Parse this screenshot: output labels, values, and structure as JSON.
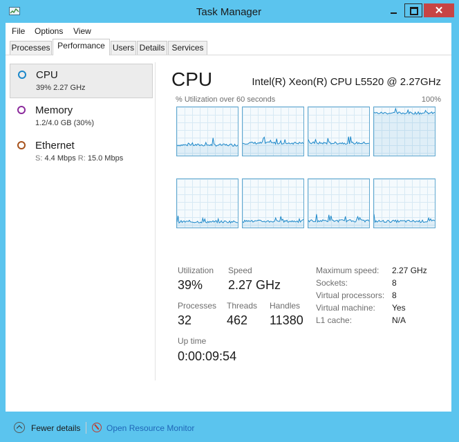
{
  "window": {
    "title": "Task Manager",
    "icon": "task-manager-icon",
    "controls": {
      "minimize": "minimize-icon",
      "maximize": "maximize-icon",
      "close_glyph": "✕"
    }
  },
  "menu": {
    "file": "File",
    "options": "Options",
    "view": "View"
  },
  "tabs": {
    "processes": "Processes",
    "performance": "Performance",
    "users": "Users",
    "details": "Details",
    "services": "Services",
    "active": "Performance"
  },
  "sidebar": {
    "cpu": {
      "title": "CPU",
      "detail": "39% 2.27 GHz",
      "color": "#1b87c9"
    },
    "memory": {
      "title": "Memory",
      "detail": "1.2/4.0 GB (30%)",
      "color": "#8b2a9c"
    },
    "ethernet": {
      "title": "Ethernet",
      "send_label": "S:",
      "send_value": "4.4 Mbps",
      "recv_label": "R:",
      "recv_value": "15.0 Mbps",
      "color": "#a7521c"
    }
  },
  "cpu_panel": {
    "title": "CPU",
    "model": "Intel(R) Xeon(R) CPU L5520 @ 2.27GHz",
    "graph_label": "% Utilization over 60 seconds",
    "graph_max": "100%",
    "line_color": "#1b87c9",
    "graph_levels": [
      0.22,
      0.26,
      0.26,
      0.88,
      0.12,
      0.13,
      0.14,
      0.13
    ],
    "stats": {
      "utilization_label": "Utilization",
      "utilization_value": "39%",
      "speed_label": "Speed",
      "speed_value": "2.27 GHz",
      "processes_label": "Processes",
      "processes_value": "32",
      "threads_label": "Threads",
      "threads_value": "462",
      "handles_label": "Handles",
      "handles_value": "11380",
      "uptime_label": "Up time",
      "uptime_value": "0:00:09:54"
    },
    "specs": {
      "max_speed_label": "Maximum speed:",
      "max_speed_value": "2.27 GHz",
      "sockets_label": "Sockets:",
      "sockets_value": "8",
      "vproc_label": "Virtual processors:",
      "vproc_value": "8",
      "vm_label": "Virtual machine:",
      "vm_value": "Yes",
      "l1_label": "L1 cache:",
      "l1_value": "N/A"
    }
  },
  "footer": {
    "fewer_details": "Fewer details",
    "resource_monitor": "Open Resource Monitor"
  }
}
